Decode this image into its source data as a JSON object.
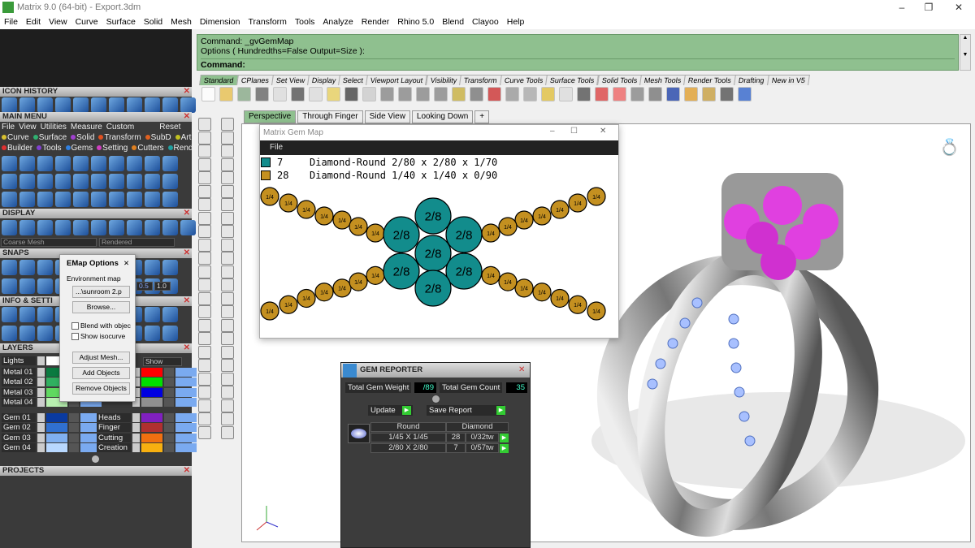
{
  "window": {
    "title": "Matrix 9.0 (64-bit) - Export.3dm"
  },
  "menubar": [
    "File",
    "Edit",
    "View",
    "Curve",
    "Surface",
    "Solid",
    "Mesh",
    "Dimension",
    "Transform",
    "Tools",
    "Analyze",
    "Render",
    "Rhino 5.0",
    "Blend",
    "Clayoo",
    "Help"
  ],
  "command": {
    "line1": "Command: _gvGemMap",
    "line2": "Options ( Hundredths=False  Output=Size ):",
    "prompt": "Command:"
  },
  "toolbar_tabs": [
    "Standard",
    "CPlanes",
    "Set View",
    "Display",
    "Select",
    "Viewport Layout",
    "Visibility",
    "Transform",
    "Curve Tools",
    "Surface Tools",
    "Solid Tools",
    "Mesh Tools",
    "Render Tools",
    "Drafting",
    "New in V5"
  ],
  "viewport_tabs": [
    "Perspective",
    "Through Finger",
    "Side View",
    "Looking Down"
  ],
  "viewport_label": "Perspective",
  "left": {
    "icon_history": "ICON HISTORY",
    "main_menu": "MAIN MENU",
    "mm_menu": [
      "File",
      "View",
      "Utilities",
      "Measure",
      "Custom"
    ],
    "mm_reset": "Reset",
    "mm_row1": [
      {
        "l": "Curve",
        "c": "#d8c030"
      },
      {
        "l": "Surface",
        "c": "#30b070"
      },
      {
        "l": "Solid",
        "c": "#a040d0"
      },
      {
        "l": "Transform",
        "c": "#e05020"
      },
      {
        "l": "SubD",
        "c": "#e06020"
      },
      {
        "l": "Art",
        "c": "#c0c020"
      }
    ],
    "mm_row2": [
      {
        "l": "Builder",
        "c": "#e03030"
      },
      {
        "l": "Tools",
        "c": "#8040d0"
      },
      {
        "l": "Gems",
        "c": "#3080e0"
      },
      {
        "l": "Setting",
        "c": "#d040c0"
      },
      {
        "l": "Cutters",
        "c": "#e08020"
      },
      {
        "l": "Render",
        "c": "#20a0a0"
      }
    ],
    "display": "DISPLAY",
    "mesh_select": "Coarse Mesh",
    "render_select": "Rendered",
    "snaps": "SNAPS",
    "snap_v1": "0.5",
    "snap_v2": "1.0",
    "info": "INFO & SETTI",
    "layers": "LAYERS",
    "projects": "PROJECTS",
    "show_label": "Show",
    "layers_left": [
      {
        "n": "Lights",
        "c": "#ffffff"
      },
      {
        "n": "Metal 01",
        "c": "#0a7a40"
      },
      {
        "n": "Metal 02",
        "c": "#30b060"
      },
      {
        "n": "Metal 03",
        "c": "#60d860"
      },
      {
        "n": "Metal 04",
        "c": "#b8f0b0"
      },
      {
        "n": "Gem 01",
        "c": "#0a3aa0"
      },
      {
        "n": "Gem 02",
        "c": "#3070d0"
      },
      {
        "n": "Gem 03",
        "c": "#80b0f0"
      },
      {
        "n": "Gem 04",
        "c": "#b8d8ff"
      }
    ],
    "layers_right": [
      {
        "n": "Heads",
        "c": "#8020c0"
      },
      {
        "n": "Finger",
        "c": "#b03030"
      },
      {
        "n": "Cutting",
        "c": "#f07010"
      },
      {
        "n": "Creation",
        "c": "#f8b010"
      }
    ],
    "layers_right_hidden_colors": [
      "#ff0000",
      "#00e000",
      "#0000e0",
      "#909090"
    ]
  },
  "emap": {
    "title": "EMap Options",
    "env_label": "Environment map",
    "env_value": "...\\sunroom 2.p",
    "browse": "Browse...",
    "blend": "Blend with objec",
    "iso": "Show isocurve",
    "adjust": "Adjust Mesh...",
    "add": "Add Objects",
    "remove": "Remove Objects"
  },
  "gemmap": {
    "title": "Matrix Gem Map",
    "menu": "File",
    "legend": [
      {
        "count": "7",
        "desc": "Diamond-Round 2/80 x 2/80 x 1/70",
        "color": "#128c8c"
      },
      {
        "count": "28",
        "desc": "Diamond-Round 1/40 x 1/40 x 0/90",
        "color": "#c49020"
      }
    ],
    "small_label": "1/4",
    "large_label": "2/8"
  },
  "gemreporter": {
    "title": "GEM REPORTER",
    "weight_label": "Total Gem Weight",
    "weight": "/89",
    "count_label": "Total Gem Count",
    "count": "35",
    "update": "Update",
    "save": "Save Report",
    "shape": "Round",
    "type": "Diamond",
    "rows": [
      {
        "size": "1/45 X 1/45",
        "qty": "28",
        "wt": "0/32tw"
      },
      {
        "size": "2/80 X 2/80",
        "qty": "7",
        "wt": "0/57tw"
      }
    ]
  }
}
